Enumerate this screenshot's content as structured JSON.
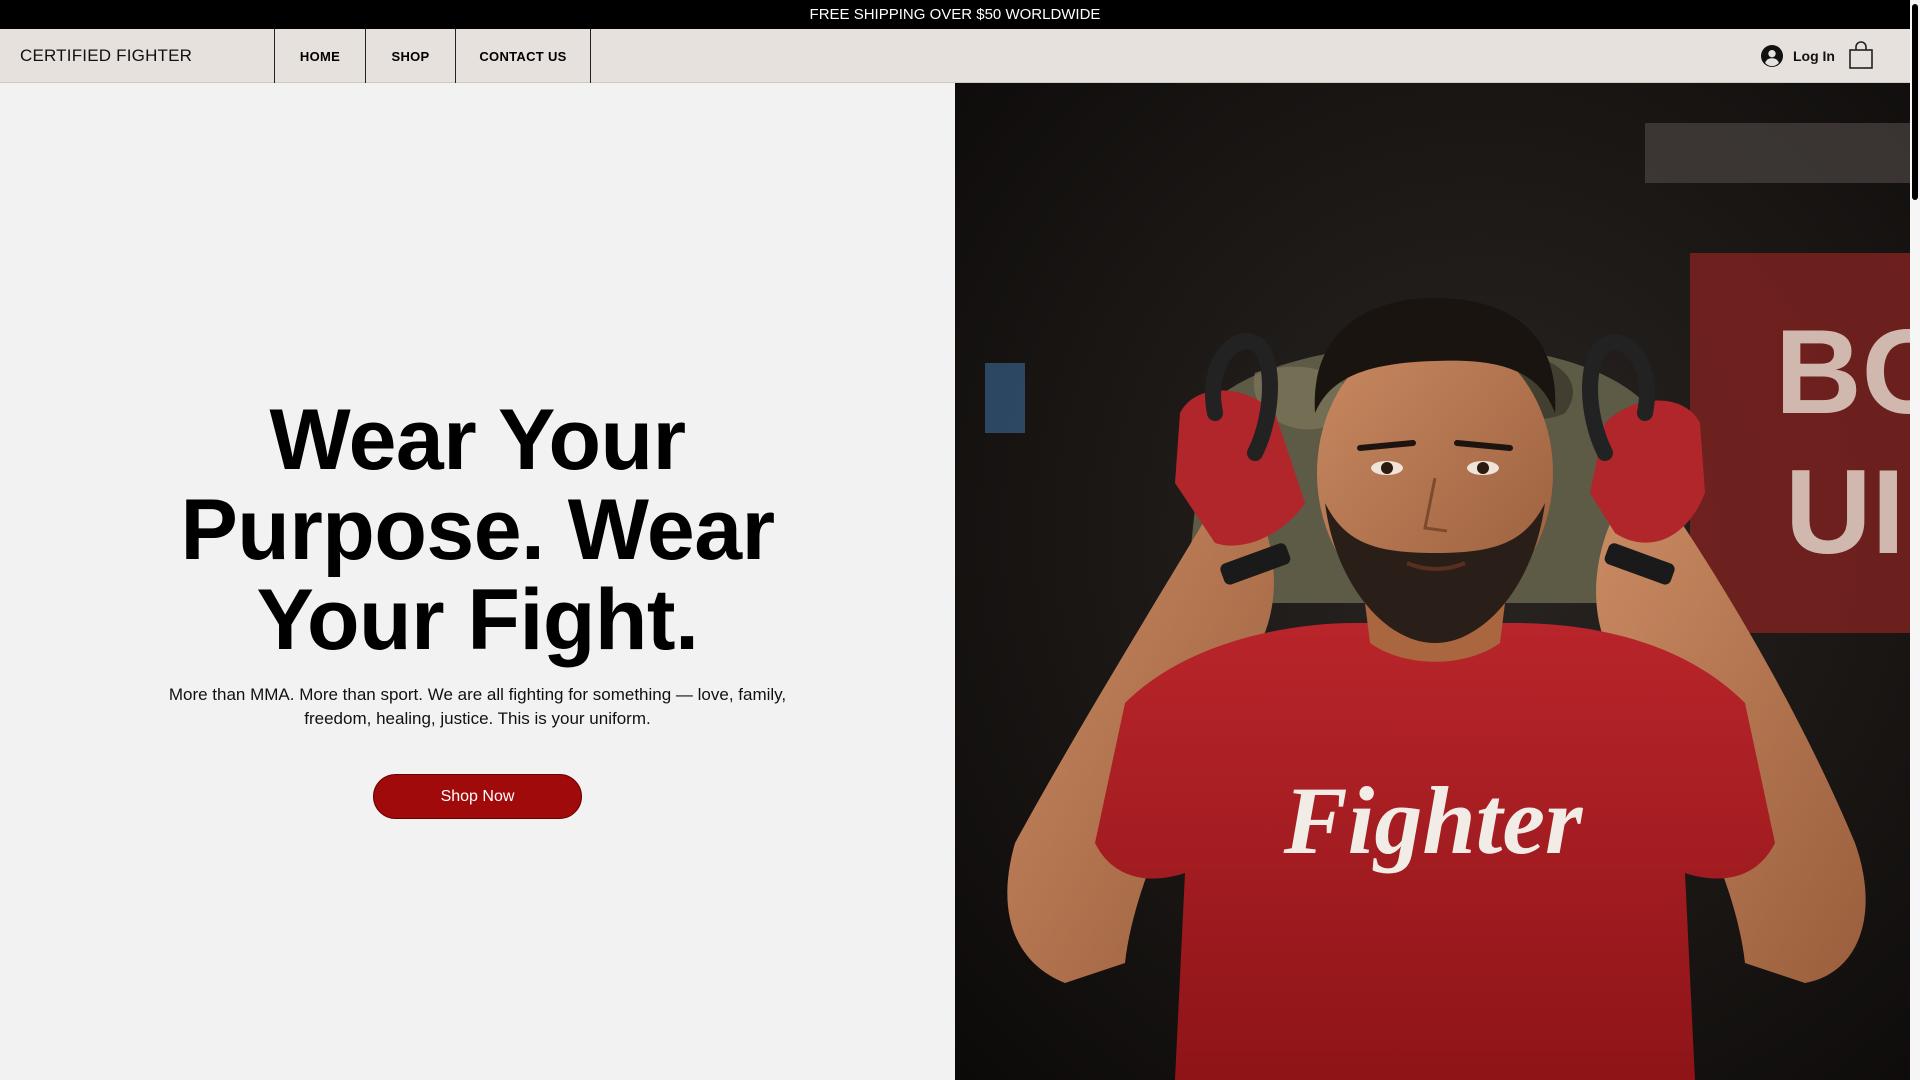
{
  "announcement": "FREE SHIPPING OVER $50 WORLDWIDE",
  "brand": "CERTIFIED FIGHTER",
  "nav": [
    {
      "label": "HOME"
    },
    {
      "label": "SHOP"
    },
    {
      "label": "CONTACT US"
    }
  ],
  "login_label": "Log In",
  "hero": {
    "headline_lines": [
      "Wear Your",
      "Purpose. Wear",
      "Your Fight."
    ],
    "subtext": "More than MMA. More than sport. We are all fighting for something — love, family, freedom, healing, justice. This is your uniform.",
    "cta": "Shop Now",
    "shirt_text": "Fighter",
    "wall_text": [
      "BO",
      "UI"
    ]
  },
  "icons": [
    "user-avatar-icon",
    "shopping-bag-icon"
  ],
  "colors": {
    "accent": "#a00a0a",
    "header_bg": "#e6e1dc",
    "announce_bg": "#000000",
    "shirt": "#b51e22"
  }
}
